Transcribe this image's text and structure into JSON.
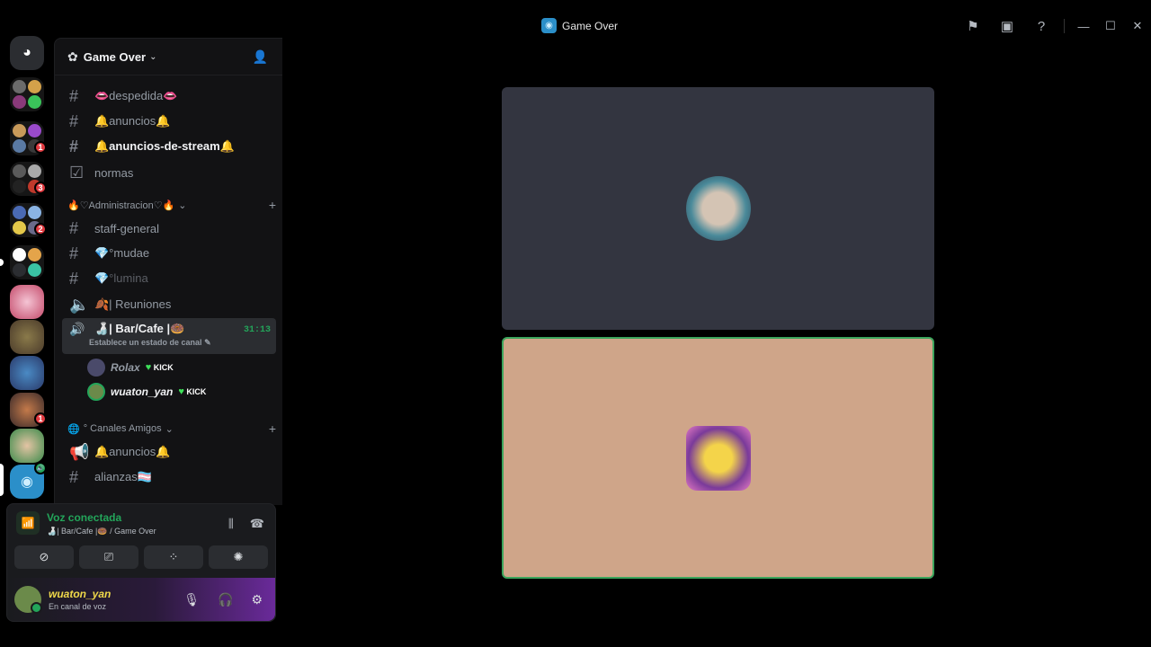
{
  "window": {
    "title": "Game Over"
  },
  "titlebar_icons": [
    "flag-icon",
    "screen-share-icon",
    "help-icon"
  ],
  "server_badges": [
    "1",
    "3",
    "2",
    "1"
  ],
  "guild": {
    "name": "Game Over"
  },
  "channels": {
    "despedida": "👄despedida👄",
    "anuncios": "🔔anuncios🔔",
    "anuncios_stream": "🔔anuncios-de-stream🔔",
    "normas": "normas",
    "cat_admin": "🔥♡Administracion♡🔥",
    "staff_general": "staff-general",
    "mudae": "💎°mudae",
    "lumina": "💎°lumina",
    "reuniones": "🍂| Reuniones",
    "bar_cafe": "🍶| Bar/Cafe |🍩",
    "bar_status": "Establece un estado de canal",
    "bar_timer": "31:13",
    "cat_amigos": "° Canales Amigos",
    "anuncios_amigos": "🔔anuncios🔔",
    "alianzas": "alianzas🏳️‍⚧️"
  },
  "voice_users": [
    {
      "name": "Rolax",
      "tag": "KICK"
    },
    {
      "name": "wuaton_yan",
      "tag": "KICK"
    }
  ],
  "voice_panel": {
    "status": "Voz conectada",
    "location": "🍶| Bar/Cafe |🍩 / Game Over"
  },
  "user": {
    "name": "wuaton_yan",
    "status": "En canal de voz"
  },
  "colors": {
    "connected": "#23a55a",
    "tile_active_border": "#3ba55c",
    "tile1_bg": "#333540",
    "tile2_bg": "#cfa589"
  }
}
